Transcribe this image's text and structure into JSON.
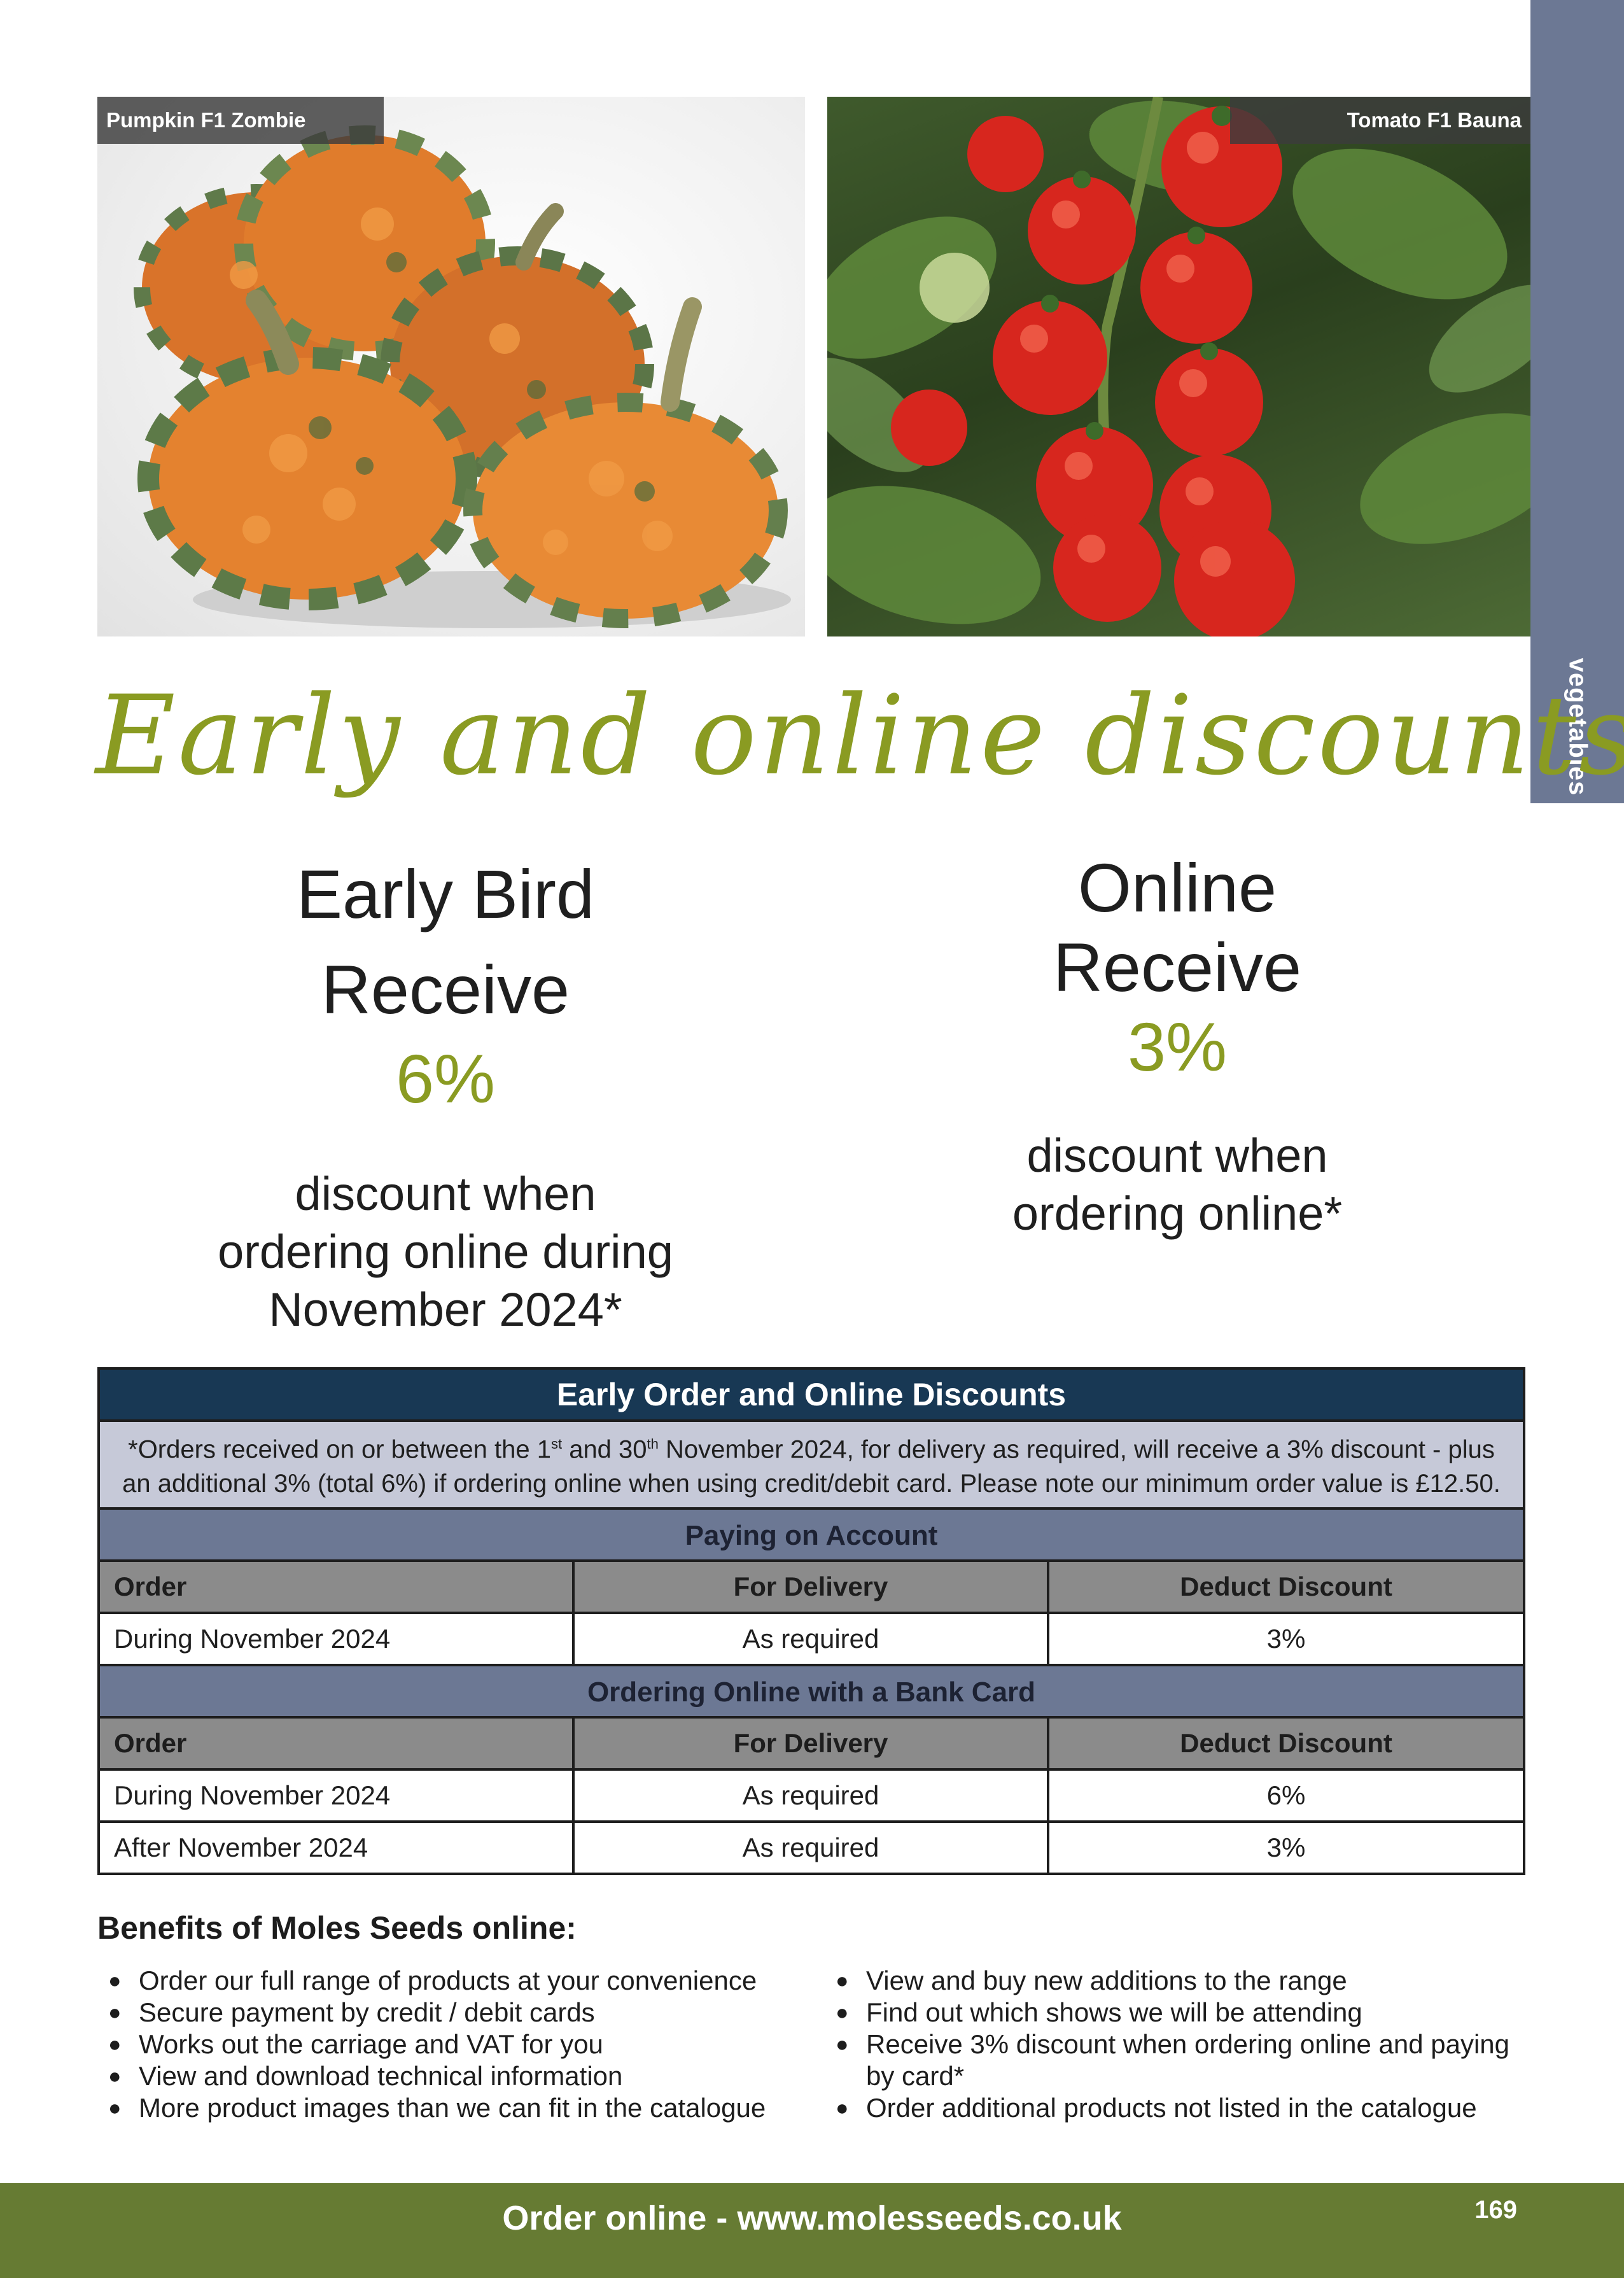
{
  "side_tab": {
    "label": "vegetables",
    "color": "#6c7894"
  },
  "photos": {
    "left": {
      "caption": "Pumpkin F1 Zombie"
    },
    "right": {
      "caption": "Tomato F1 Bauna"
    }
  },
  "headline": {
    "text": "Early and online discounts",
    "color": "#8a9b22"
  },
  "offers": {
    "early_bird": {
      "line1": "Early Bird",
      "line2": "Receive",
      "percent": "6%",
      "desc": [
        "discount when",
        "ordering online during",
        "November 2024*"
      ]
    },
    "online": {
      "line1": "Online",
      "line2": "Receive",
      "percent": "3%",
      "desc": [
        "discount when",
        "ordering online*"
      ]
    }
  },
  "table": {
    "title": "Early Order and Online Discounts",
    "note": {
      "p1": "*Orders received on or between the 1",
      "sup1": "st",
      "p2": " and 30",
      "sup2": "th",
      "p3": " November 2024, for delivery as required, will receive a 3% discount - plus an additional 3% (total 6%) if ordering online when using credit/debit card.  Please note our minimum order value is £12.50."
    },
    "sections": [
      {
        "title": "Paying on Account",
        "headers": [
          "Order",
          "For Delivery",
          "Deduct Discount"
        ],
        "rows": [
          [
            "During November 2024",
            "As required",
            "3%"
          ]
        ]
      },
      {
        "title": "Ordering Online with a Bank Card",
        "headers": [
          "Order",
          "For Delivery",
          "Deduct Discount"
        ],
        "rows": [
          [
            "During November 2024",
            "As required",
            "6%"
          ],
          [
            "After November 2024",
            "As required",
            "3%"
          ]
        ]
      }
    ],
    "colors": {
      "title_bg": "#183854",
      "note_bg": "#c6c9d8",
      "section_bg": "#6c7894",
      "header_bg": "#8b8b8b"
    }
  },
  "benefits": {
    "title": "Benefits of Moles Seeds online:",
    "left": [
      "Order our full range of products at your convenience",
      "Secure payment by credit / debit cards",
      "Works out the carriage and VAT for you",
      "View and download technical information",
      "More product images than we can fit in the catalogue"
    ],
    "right": [
      "View and buy new additions to the range",
      "Find out which shows we will be attending",
      "Receive 3% discount when ordering online and paying by card*",
      "Order additional products not listed in the catalogue"
    ]
  },
  "footer": {
    "text": "Order online - www.molesseeds.co.uk",
    "page_number": "169",
    "color": "#667b33"
  }
}
